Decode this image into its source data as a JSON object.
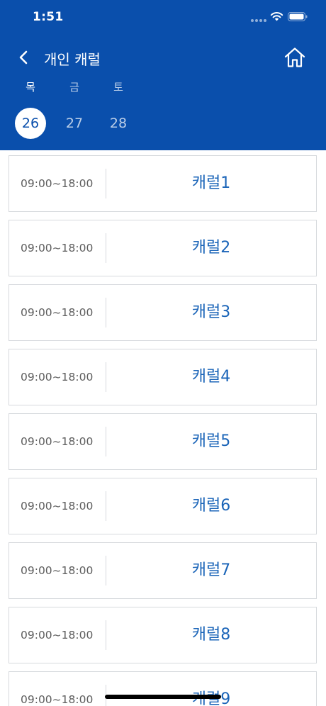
{
  "status_bar": {
    "time": "1:51"
  },
  "nav": {
    "title": "개인 캐럴",
    "back_icon": "chevron-left-icon",
    "home_icon": "home-icon"
  },
  "calendar": {
    "weekdays": [
      "목",
      "금",
      "토"
    ],
    "dates": [
      "26",
      "27",
      "28"
    ],
    "selected_date": "26"
  },
  "carols": [
    {
      "time": "09:00~18:00",
      "name": "캐럴1"
    },
    {
      "time": "09:00~18:00",
      "name": "캐럴2"
    },
    {
      "time": "09:00~18:00",
      "name": "캐럴3"
    },
    {
      "time": "09:00~18:00",
      "name": "캐럴4"
    },
    {
      "time": "09:00~18:00",
      "name": "캐럴5"
    },
    {
      "time": "09:00~18:00",
      "name": "캐럴6"
    },
    {
      "time": "09:00~18:00",
      "name": "캐럴7"
    },
    {
      "time": "09:00~18:00",
      "name": "캐럴8"
    },
    {
      "time": "09:00~18:00",
      "name": "캐럴9"
    }
  ],
  "colors": {
    "header": "#0a4fac",
    "accent_text": "#1a64b8"
  }
}
